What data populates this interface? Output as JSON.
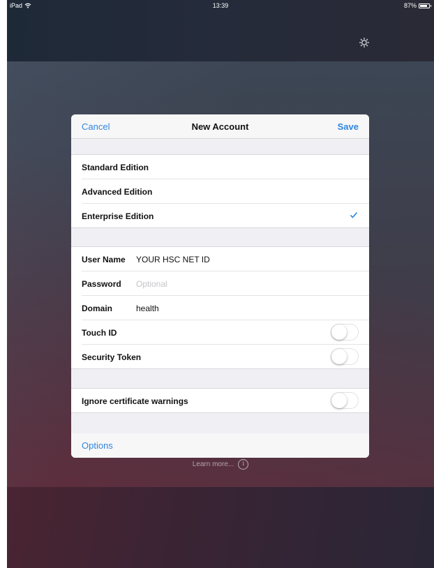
{
  "status_bar": {
    "device": "iPad",
    "time": "13:39",
    "battery": "87%",
    "battery_level": 0.87
  },
  "header": {
    "settings_icon": "gear-icon"
  },
  "dialog": {
    "cancel_label": "Cancel",
    "title": "New Account",
    "save_label": "Save",
    "editions": [
      {
        "label": "Standard Edition",
        "selected": false
      },
      {
        "label": "Advanced Edition",
        "selected": false
      },
      {
        "label": "Enterprise Edition",
        "selected": true
      }
    ],
    "credentials": {
      "user_name_label": "User Name",
      "user_name_value": "YOUR HSC NET ID",
      "password_label": "Password",
      "password_placeholder": "Optional",
      "domain_label": "Domain",
      "domain_value": "health",
      "touch_id_label": "Touch ID",
      "touch_id_on": false,
      "security_token_label": "Security Token",
      "security_token_on": false
    },
    "ignore_cert_label": "Ignore certificate warnings",
    "ignore_cert_on": false,
    "options_label": "Options"
  },
  "footer": {
    "learn_more": "Learn more...",
    "info_glyph": "i"
  },
  "colors": {
    "accent": "#2f86e0"
  }
}
